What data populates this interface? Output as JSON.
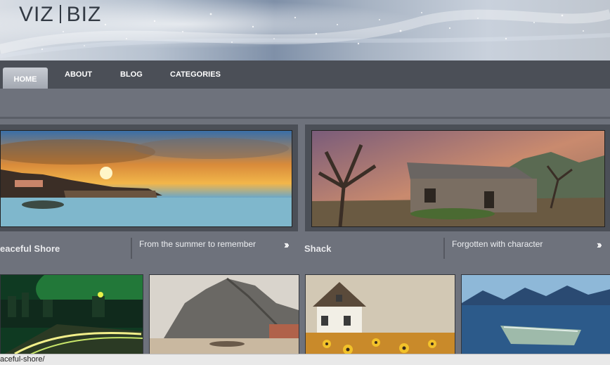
{
  "site": {
    "logo_left": "VIZ",
    "logo_right": "BIZ"
  },
  "nav": {
    "items": [
      {
        "label": "HOME",
        "active": true
      },
      {
        "label": "ABOUT",
        "active": false
      },
      {
        "label": "BLOG",
        "active": false
      },
      {
        "label": "CATEGORIES",
        "active": false
      }
    ]
  },
  "slides": [
    {
      "title": "eaceful Shore",
      "caption": "From the summer to remember",
      "more_icon": "double-chevron-right-icon"
    },
    {
      "title": "Shack",
      "caption": "Forgotten with character",
      "more_icon": "double-chevron-right-icon"
    }
  ],
  "status": {
    "url": "aceful-shore/"
  }
}
